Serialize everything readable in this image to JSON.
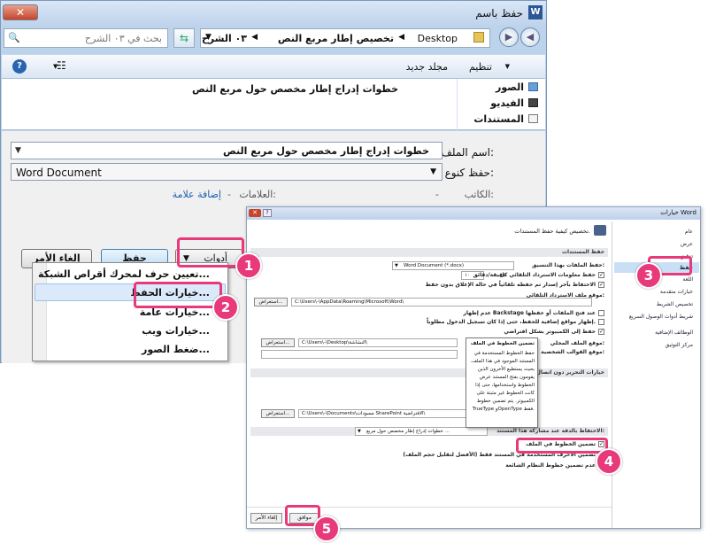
{
  "save_dialog": {
    "title": "حفظ باسم",
    "breadcrumb": [
      "Desktop",
      "تخصيص إطار مربع النص",
      "٠٣ الشرح"
    ],
    "search_placeholder": "بحث في ٠٣ الشرح",
    "toolbar": {
      "organize": "تنظيم",
      "new_folder": "مجلد جديد"
    },
    "nav_items": [
      "الصور",
      "الفيديو",
      "المستندات"
    ],
    "file_item": "خطوات إدراج إطار مخصص حول مربع النص",
    "filename_label": "اسم الملف:",
    "filename_value": "خطوات إدراج إطار مخصص حول مربع النص",
    "filetype_label": "حفظ كنوع:",
    "filetype_value": "Word Document",
    "authors_label": "الكاتب:",
    "authors_value": "-",
    "tags_label": "العلامات:",
    "tags_value": "-",
    "add_tag": "إضافة علامة",
    "tools_button": "أدوات",
    "save_button": "حفظ",
    "cancel_button": "إلغاء الأمر",
    "tools_menu": [
      "تعيين حرف لمحرك أقراص الشبكة...",
      "خيارات الحفظ...",
      "خيارات عامة...",
      "خيارات ويب...",
      "ضغط الصور..."
    ]
  },
  "options_dialog": {
    "title": "خيارات Word",
    "header": "تخصيص كيفية حفظ المستندات.",
    "section_save": "حفظ المستندات",
    "format_label": "حفظ الملفات بهذا التنسيق:",
    "format_value": "Word Document (*.docx)",
    "autorecover_label": "حفظ معلومات الاسترداد التلقائي كل",
    "autorecover_minutes": "١٠",
    "minutes_label": "دقيقة/دقائق",
    "keep_last_label": "الاحتفاظ بآخر إصدار تم حفظه تلقائياً في حالة الإغلاق بدون حفظ",
    "autorecover_location_label": "موقع ملف الاسترداد التلقائي:",
    "autorecover_path": "C:\\Users\\-\\AppData\\Roaming\\Microsoft\\Word\\",
    "browse": "استعراض...",
    "backstage_label": "عدم إظهار Backstage عند فتح الملفات أو حفظها",
    "additional_places_label": "إظهار مواقع إضافية للحفظ، حتى إذا كان تسجيل الدخول مطلوباً.",
    "save_computer_label": "حفظ إلى الكمبيوتر بشكل افتراضي",
    "local_files_label": "موقع الملف المحلي:",
    "local_path": "C:\\Users\\-\\Desktop\\النشاشة\\",
    "templates_label": "موقع القوالب الشخصية:",
    "section_offline": "خيارات التحرير دون اتصال",
    "offline_path": "C:\\Users\\-\\Documents\\مسودات SharePoint الافتراضية\\",
    "section_fidelity": "الاحتفاظ بالدقة عند مشاركة هذا المستند:",
    "fidelity_doc": "خطوات إدراج إطار مخصص حول مربع ...",
    "embed_fonts_label": "تضمين الخطوط في الملف",
    "embed_chars_label": "تضمين الأحرف المستخدمة في المستند فقط (الأفضل لتقليل حجم الملف)",
    "no_common_fonts_label": "عدم تضمين خطوط النظام الشائعة",
    "tooltip_title": "تضمين الخطوط في الملف",
    "tooltip_body": "حفظ الخطوط المستخدمة في المستند الموجود في هذا الملف. بحيث يستطيع الأخرون الذين يقومون بفتح المستند عرض الخطوط واستخدامها، حتى إذا كانت الخطوط غير مثبتة على الكمبيوتر. يتم تضمين خطوط TrueType وOpenType فقط.",
    "nav_items": [
      "عام",
      "عرض",
      "تدقيق",
      "حفظ",
      "اللغة",
      "خيارات متقدمة",
      "تخصيص الشريط",
      "شريط أدوات الوصول السريع",
      "الوظائف الإضافية",
      "مركز التوثيق"
    ],
    "ok_button": "موافق",
    "cancel_button": "إلغاء الأمر"
  },
  "callouts": [
    "1",
    "2",
    "3",
    "4",
    "5"
  ],
  "colors": {
    "highlight": "#e83a7a",
    "link": "#1a5fb4"
  }
}
